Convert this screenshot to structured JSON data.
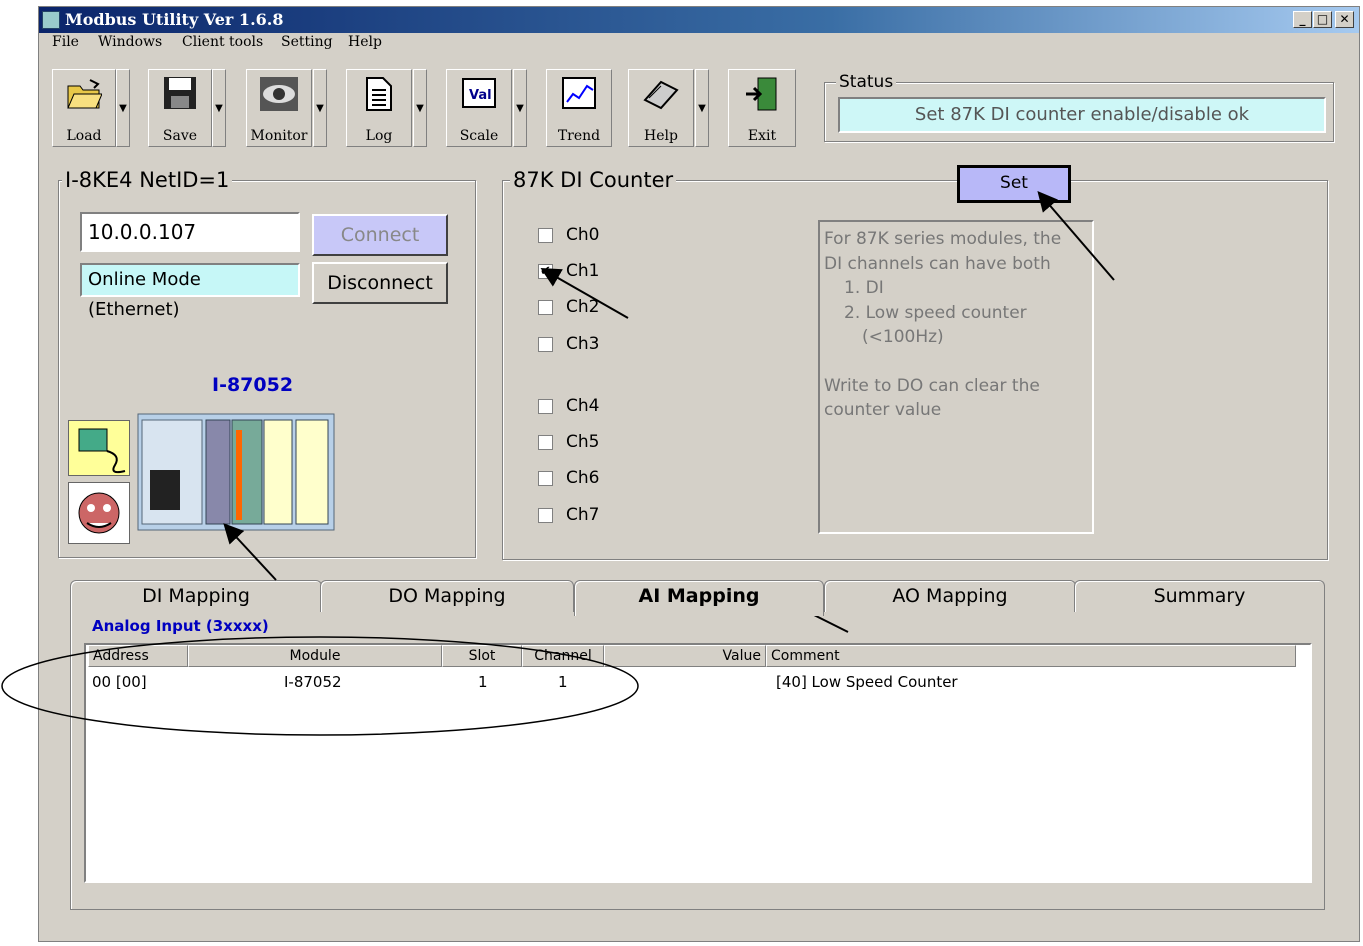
{
  "window": {
    "title": "Modbus Utility   Ver 1.6.8"
  },
  "menu": [
    "File",
    "Windows",
    "Client tools",
    "Setting",
    "Help"
  ],
  "toolbar": {
    "load": "Load",
    "save": "Save",
    "monitor": "Monitor",
    "log": "Log",
    "scale": "Scale",
    "trend": "Trend",
    "help": "Help",
    "exit": "Exit",
    "scale_icon_text": "Val"
  },
  "status": {
    "label": "Status",
    "text": "Set 87K DI counter enable/disable ok"
  },
  "device": {
    "group_label": "I-8KE4    NetID=1",
    "ip": "10.0.0.107",
    "connect": "Connect",
    "mode": "Online Mode (Ethernet)",
    "disconnect": "Disconnect",
    "module_name": "I-87052"
  },
  "counter": {
    "group_label": "87K DI Counter",
    "set": "Set",
    "channels": [
      {
        "label": "Ch0",
        "checked": false
      },
      {
        "label": "Ch1",
        "checked": true
      },
      {
        "label": "Ch2",
        "checked": false
      },
      {
        "label": "Ch3",
        "checked": false
      },
      {
        "label": "Ch4",
        "checked": false
      },
      {
        "label": "Ch5",
        "checked": false
      },
      {
        "label": "Ch6",
        "checked": false
      },
      {
        "label": "Ch7",
        "checked": false
      }
    ],
    "info": {
      "line1": "For 87K series modules, the",
      "line2": "DI channels can have both",
      "line3": "1. DI",
      "line4": "2. Low speed counter",
      "line5": "(<100Hz)",
      "line6": "Write to DO can clear the",
      "line7": "counter value"
    }
  },
  "tabs": {
    "di": "DI Mapping",
    "do": "DO Mapping",
    "ai": "AI Mapping",
    "ao": "AO Mapping",
    "summary": "Summary",
    "active": "AI Mapping"
  },
  "table": {
    "title": "Analog Input  (3xxxx)",
    "columns": {
      "address": "Address",
      "module": "Module",
      "slot": "Slot",
      "channel": "Channel",
      "value": "Value",
      "comment": "Comment"
    },
    "rows": [
      {
        "address": "00 [00]",
        "module": "I-87052",
        "slot": "1",
        "channel": "1",
        "value": "",
        "comment": "[40] Low Speed Counter"
      }
    ]
  },
  "colors": {
    "face": "#d4d0c8",
    "title_start": "#0a246a",
    "status_bg": "#cef7f7",
    "mode_bg": "#c6f7f7",
    "set_bg": "#b8b8f8",
    "connect_bg": "#c8c8f8",
    "module_label": "#0000c0"
  }
}
